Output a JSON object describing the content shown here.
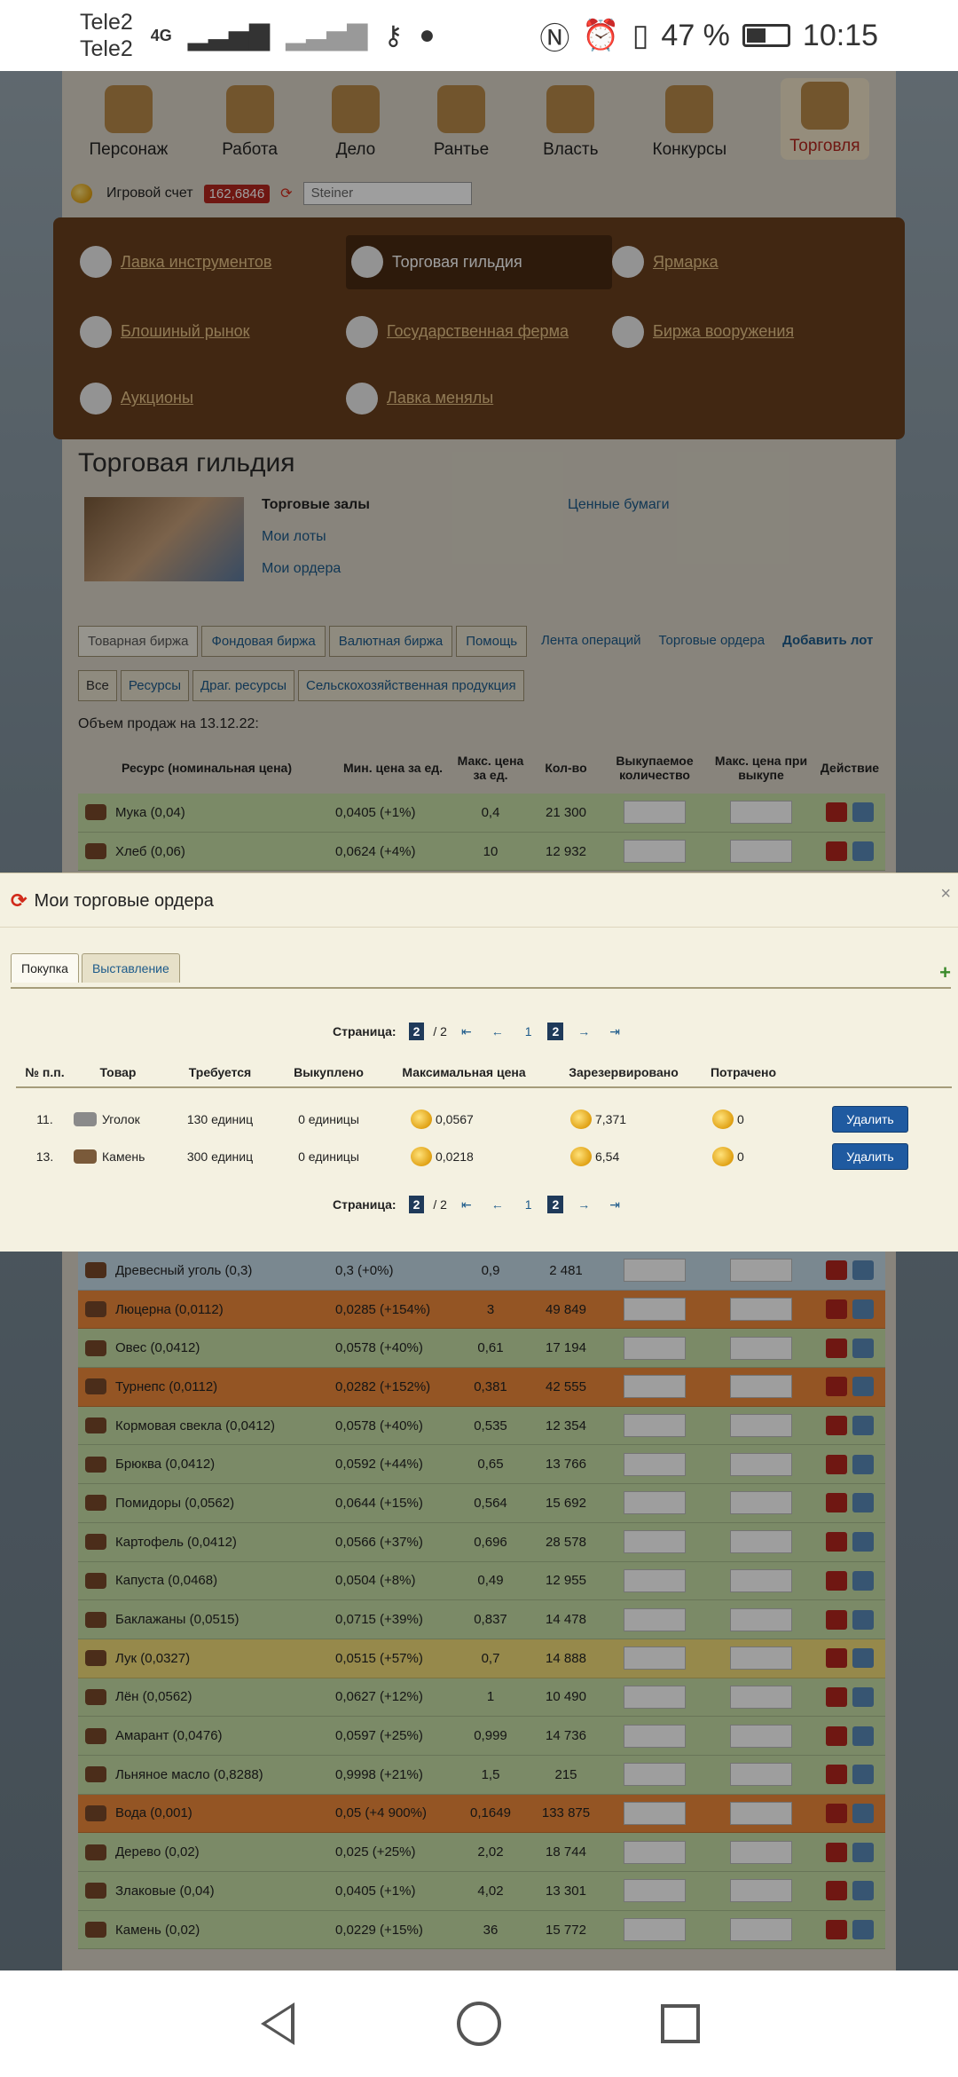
{
  "status": {
    "carrier1": "Tele2",
    "carrier2": "Tele2",
    "net": "4G",
    "battery_pct": "47 %",
    "time": "10:15",
    "battery_level": 0.47
  },
  "nav": [
    "Персонаж",
    "Работа",
    "Дело",
    "Рантье",
    "Власть",
    "Конкурсы",
    "Торговля"
  ],
  "toolbar": {
    "account_label": "Игровой счет",
    "balance": "162,6846",
    "player_select": "Steiner"
  },
  "menu": [
    "Лавка инструментов",
    "Торговая гильдия",
    "Ярмарка",
    "Блошиный рынок",
    "Государственная ферма",
    "Биржа вооружения",
    "Аукционы",
    "Лавка менялы"
  ],
  "guild": {
    "title": "Торговая гильдия",
    "link1": "Торговые залы",
    "link2": "Мои лоты",
    "link3": "Мои ордера",
    "link4": "Ценные бумаги"
  },
  "tabs1": [
    "Товарная биржа",
    "Фондовая биржа",
    "Валютная биржа",
    "Помощь"
  ],
  "tabs1_right": [
    "Лента операций",
    "Торговые ордера",
    "Добавить лот"
  ],
  "tabs2": [
    "Все",
    "Ресурсы",
    "Драг. ресурсы",
    "Сельскохозяйственная продукция"
  ],
  "sales_date": "Объем продаж на 13.12.22:",
  "bg_headers": [
    "Ресурс (номинальная цена)",
    "Мин. цена за ед.",
    "Макс. цена за ед.",
    "Кол-во",
    "Выкупаемое количество",
    "Макс. цена при выкупе",
    "Действие"
  ],
  "bg_rows_top": [
    {
      "name": "Мука (0,04)",
      "min": "0,0405 (+1%)",
      "max": "0,4",
      "qty": "21 300",
      "c": "c-green"
    },
    {
      "name": "Хлеб (0,06)",
      "min": "0,0624 (+4%)",
      "max": "10",
      "qty": "12 932",
      "c": "c-green"
    }
  ],
  "bg_rows": [
    {
      "name": "Древесный уголь (0,3)",
      "min": "0,3 (+0%)",
      "max": "0,9",
      "qty": "2 481",
      "c": "c-blue"
    },
    {
      "name": "Люцерна (0,0112)",
      "min": "0,0285 (+154%)",
      "max": "3",
      "qty": "49 849",
      "c": "c-orange"
    },
    {
      "name": "Овес (0,0412)",
      "min": "0,0578 (+40%)",
      "max": "0,61",
      "qty": "17 194",
      "c": "c-green"
    },
    {
      "name": "Турнепс (0,0112)",
      "min": "0,0282 (+152%)",
      "max": "0,381",
      "qty": "42 555",
      "c": "c-orange"
    },
    {
      "name": "Кормовая свекла (0,0412)",
      "min": "0,0578 (+40%)",
      "max": "0,535",
      "qty": "12 354",
      "c": "c-green"
    },
    {
      "name": "Брюква (0,0412)",
      "min": "0,0592 (+44%)",
      "max": "0,65",
      "qty": "13 766",
      "c": "c-green"
    },
    {
      "name": "Помидоры (0,0562)",
      "min": "0,0644 (+15%)",
      "max": "0,564",
      "qty": "15 692",
      "c": "c-green"
    },
    {
      "name": "Картофель (0,0412)",
      "min": "0,0566 (+37%)",
      "max": "0,696",
      "qty": "28 578",
      "c": "c-green"
    },
    {
      "name": "Капуста (0,0468)",
      "min": "0,0504 (+8%)",
      "max": "0,49",
      "qty": "12 955",
      "c": "c-green"
    },
    {
      "name": "Баклажаны (0,0515)",
      "min": "0,0715 (+39%)",
      "max": "0,837",
      "qty": "14 478",
      "c": "c-green"
    },
    {
      "name": "Лук (0,0327)",
      "min": "0,0515 (+57%)",
      "max": "0,7",
      "qty": "14 888",
      "c": "c-yellow"
    },
    {
      "name": "Лён (0,0562)",
      "min": "0,0627 (+12%)",
      "max": "1",
      "qty": "10 490",
      "c": "c-green"
    },
    {
      "name": "Амарант (0,0476)",
      "min": "0,0597 (+25%)",
      "max": "0,999",
      "qty": "14 736",
      "c": "c-green"
    },
    {
      "name": "Льняное масло (0,8288)",
      "min": "0,9998 (+21%)",
      "max": "1,5",
      "qty": "215",
      "c": "c-green"
    },
    {
      "name": "Вода (0,001)",
      "min": "0,05 (+4 900%)",
      "max": "0,1649",
      "qty": "133 875",
      "c": "c-orange"
    },
    {
      "name": "Дерево (0,02)",
      "min": "0,025 (+25%)",
      "max": "2,02",
      "qty": "18 744",
      "c": "c-green"
    },
    {
      "name": "Злаковые (0,04)",
      "min": "0,0405 (+1%)",
      "max": "4,02",
      "qty": "13 301",
      "c": "c-green"
    },
    {
      "name": "Камень (0,02)",
      "min": "0,0229 (+15%)",
      "max": "36",
      "qty": "15 772",
      "c": "c-green"
    }
  ],
  "modal": {
    "title": "Мои торговые ордера",
    "tab_buy": "Покупка",
    "tab_sell": "Выставление",
    "pager_label": "Страница:",
    "pager_current": "2",
    "pager_total": "/ 2",
    "page1": "1",
    "page2": "2",
    "headers": [
      "№ п.п.",
      "Товар",
      "Требуется",
      "Выкуплено",
      "Максимальная цена",
      "Зарезервировано",
      "Потрачено"
    ],
    "rows": [
      {
        "num": "11.",
        "item": "Уголок",
        "required": "130 единиц",
        "bought": "0 единицы",
        "max_price": "0,0567",
        "reserved": "7,371",
        "spent": "0",
        "action": "Удалить",
        "icon_color": "#8a8a8a"
      },
      {
        "num": "13.",
        "item": "Камень",
        "required": "300 единиц",
        "bought": "0 единицы",
        "max_price": "0,0218",
        "reserved": "6,54",
        "spent": "0",
        "action": "Удалить",
        "icon_color": "#7a5a3a"
      }
    ]
  }
}
